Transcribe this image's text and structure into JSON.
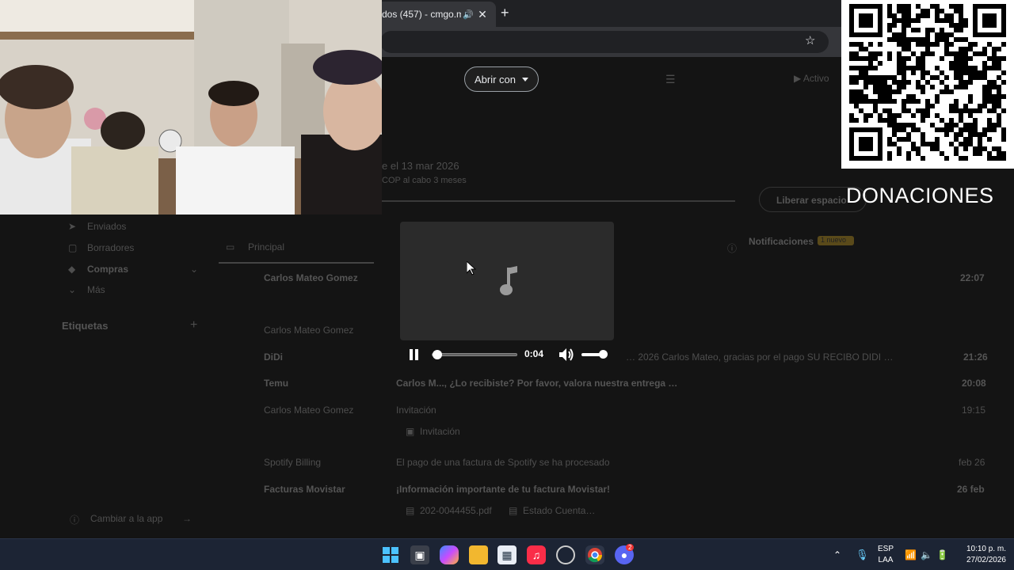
{
  "browser": {
    "tab_title": "dos (457) - cmgo.mm",
    "new_tab": "+"
  },
  "gmail": {
    "open_with": "Abrir con",
    "active_label": "Activo",
    "storage_date": "e el 13 mar 2026",
    "storage_sub": "COP al cabo 3 meses",
    "free_space_button": "Liberar espacio",
    "sidebar": [
      {
        "label": "Enviados"
      },
      {
        "label": "Borradores"
      },
      {
        "label": "Compras"
      },
      {
        "label": "Más"
      }
    ],
    "labels_heading": "Etiquetas",
    "tabs": [
      {
        "label": "Principal"
      },
      {
        "label": "Notificaciones"
      }
    ],
    "notif_badge": "1 nuevo",
    "rows": [
      {
        "sender": "Carlos Mateo Gomez",
        "subject": "",
        "date": "22:07"
      },
      {
        "sender": "Carlos Mateo Gomez",
        "subject": "",
        "date": ""
      },
      {
        "sender": "DiDi",
        "subject": "… 2026 Carlos Mateo, gracias por el pago SU RECIBO DIDI …",
        "date": "21:26"
      },
      {
        "sender": "Temu",
        "subject": "Carlos M..., ¿Lo recibiste? Por favor, valora nuestra entrega …",
        "date": "20:08"
      },
      {
        "sender": "Carlos Mateo Gomez",
        "subject": "Invitación",
        "date": "19:15"
      },
      {
        "sender": "Spotify Billing",
        "subject": "El pago de una factura de Spotify se ha procesado",
        "date": "feb 26"
      },
      {
        "sender": "Facturas Movistar",
        "subject": "¡Información importante de tu factura Movistar!",
        "date": "26 feb"
      }
    ],
    "attachment_1": "Invitación",
    "attachment_2": "202-0044455.pdf",
    "attachment_3": "Estado Cuenta…",
    "footer": "Cambiar a la app"
  },
  "player": {
    "time": "0:04",
    "progress_fraction": 0.06,
    "volume_fraction": 1.0
  },
  "overlay": {
    "donaciones": "DONACIONES"
  },
  "taskbar": {
    "lang_top": "ESP",
    "lang_bottom": "LAA",
    "time": "10:10 p. m.",
    "date": "27/02/2026",
    "discord_badge": "2"
  }
}
